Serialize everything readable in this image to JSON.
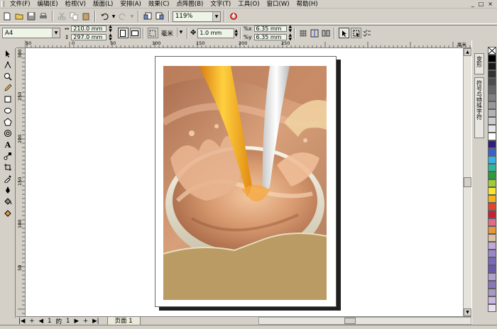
{
  "menu": [
    "文件(F)",
    "编辑(E)",
    "检视(V)",
    "版面(L)",
    "安排(A)",
    "效果(C)",
    "点阵图(B)",
    "文字(T)",
    "工具(O)",
    "窗口(W)",
    "帮助(H)"
  ],
  "window_buttons": [
    "_",
    "□",
    "×"
  ],
  "toolbar": {
    "zoom_value": "119%"
  },
  "property_bar": {
    "paper_type": "A4",
    "width": "210.0 mm",
    "height": "297.0 mm",
    "units": "毫米",
    "nudge": "1.0 mm",
    "dup_x": "6.35 mm",
    "dup_y": "6.35 mm"
  },
  "ruler": {
    "unit_label": "毫米",
    "top_ticks": [
      "0",
      "50",
      "100",
      "150",
      "200",
      "250"
    ],
    "top_first_tick": "50",
    "left_ticks": [
      "300",
      "250",
      "200",
      "150",
      "100",
      "50"
    ]
  },
  "dockers": [
    "变形",
    "符号与特殊字符"
  ],
  "page_nav": {
    "current": "1",
    "of_label": "的",
    "total": "1",
    "tab_label": "页面 1"
  },
  "palette_colors": [
    "#000000",
    "#1a1a1a",
    "#333333",
    "#4d4d4d",
    "#666666",
    "#808080",
    "#999999",
    "#b3b3b3",
    "#cccccc",
    "#e6e6e6",
    "#ffffff",
    "#2e1f7a",
    "#3a63c8",
    "#3ab0e0",
    "#2fb59a",
    "#2f9a3a",
    "#9ccc3a",
    "#f5e62e",
    "#f0b21e",
    "#e0452e",
    "#c8202e",
    "#e06a8a",
    "#e8963a",
    "#d8c0a0",
    "#c0a8d8",
    "#9a86c8",
    "#7a6ab8",
    "#6a5aa8",
    "#b0a0d0",
    "#8878b8",
    "#a898c8",
    "#c8b8e0",
    "#e8e0f0"
  ]
}
